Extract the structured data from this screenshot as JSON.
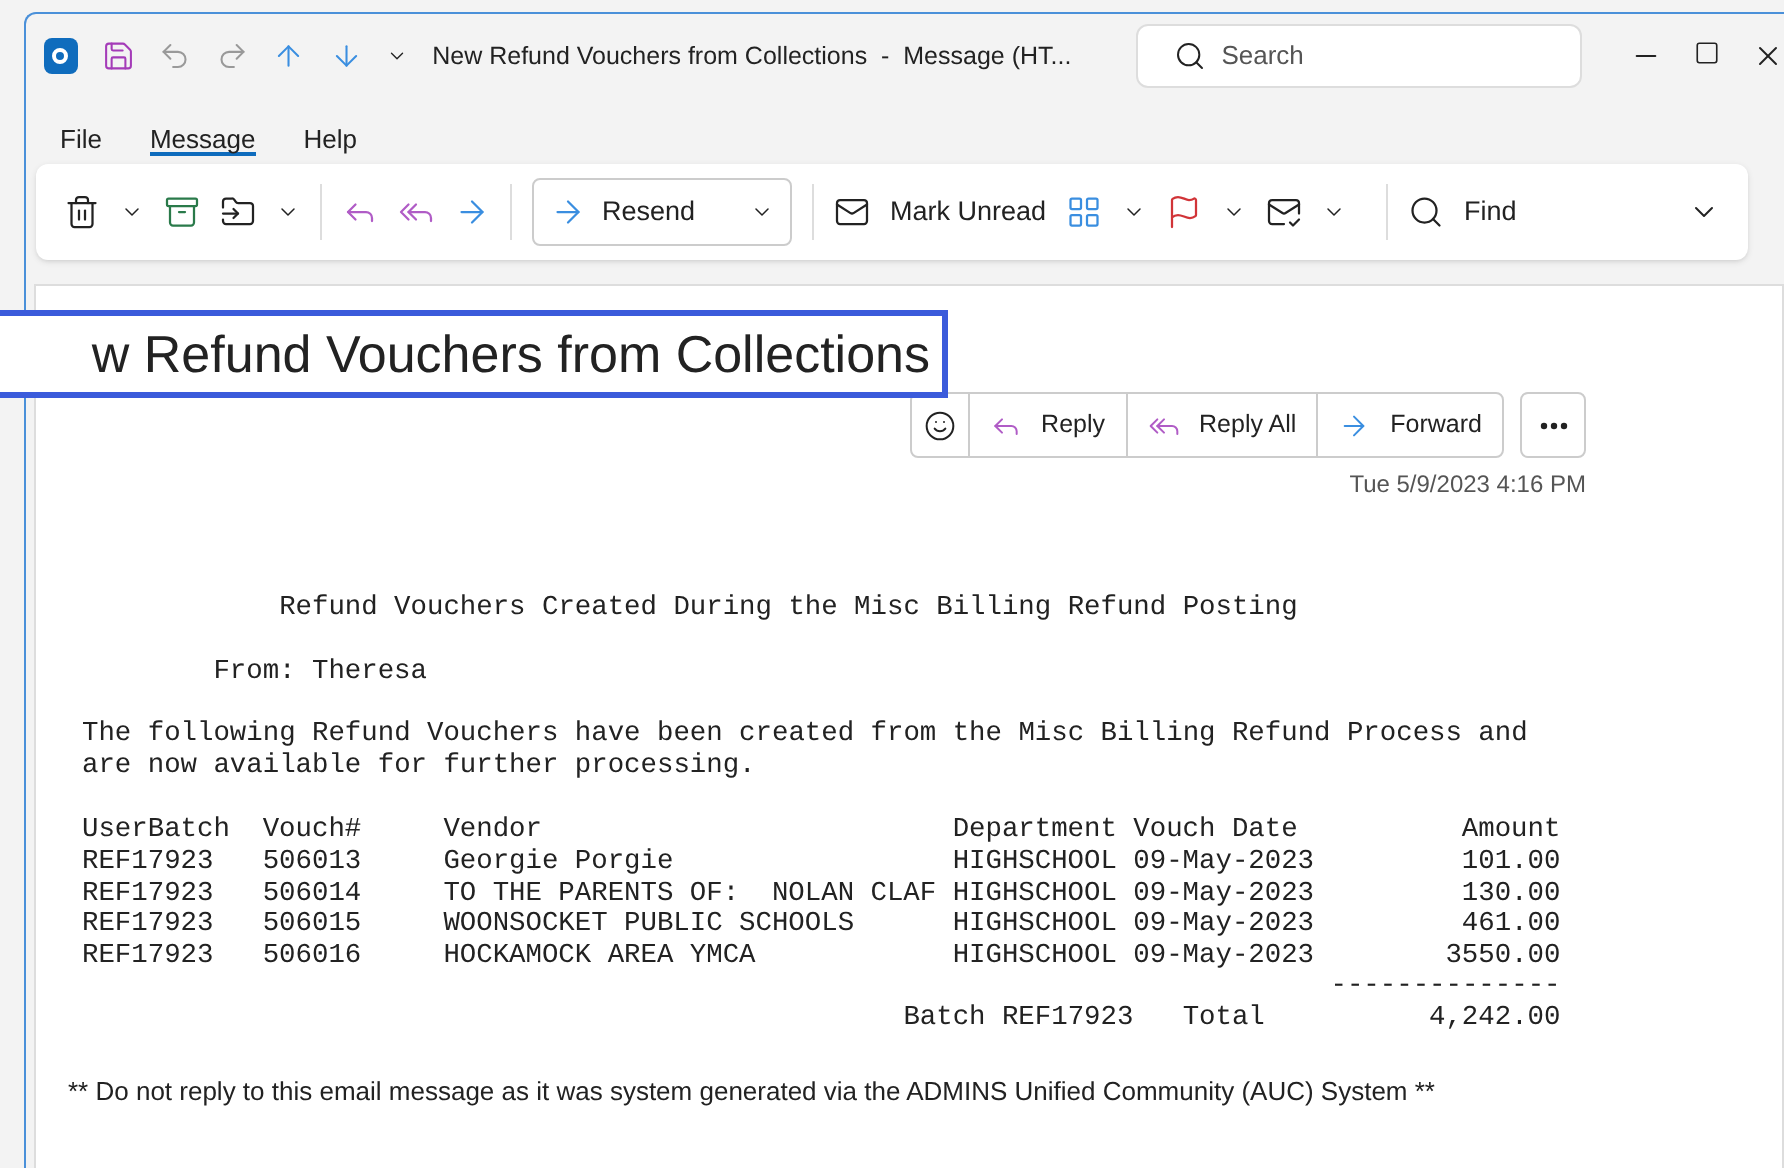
{
  "window": {
    "title": "New Refund Vouchers from Collections  -  Message (HT..."
  },
  "search": {
    "placeholder": "Search"
  },
  "menu": [
    {
      "label": "File",
      "selected": false
    },
    {
      "label": "Message",
      "selected": true
    },
    {
      "label": "Help",
      "selected": false
    }
  ],
  "ribbon": {
    "resend": "Resend",
    "mark_unread": "Mark Unread",
    "find": "Find"
  },
  "subject": "w Refund Vouchers from Collections",
  "actions": [
    "Reply",
    "Reply All",
    "Forward"
  ],
  "date": "Tue 5/9/2023 4:16 PM",
  "body": {
    "heading": "Refund Vouchers Created During the Misc Billing Refund Posting",
    "from": "From: Theresa",
    "intro": [
      "The following Refund Vouchers have been created from the Misc Billing Refund Process and",
      "are now available for further processing."
    ],
    "columns": [
      "UserBatch",
      "Vouch#",
      "Vendor",
      "Department",
      "Vouch Date",
      "Amount"
    ],
    "rows": [
      [
        "REF17923",
        "506013",
        "Georgie Porgie",
        "HIGHSCHOOL",
        "09-May-2023",
        "101.00"
      ],
      [
        "REF17923",
        "506014",
        "TO THE PARENTS OF:  NOLAN CLAF",
        "HIGHSCHOOL",
        "09-May-2023",
        "130.00"
      ],
      [
        "REF17923",
        "506015",
        "WOONSOCKET PUBLIC SCHOOLS",
        "HIGHSCHOOL",
        "09-May-2023",
        "461.00"
      ],
      [
        "REF17923",
        "506016",
        "HOCKAMOCK AREA YMCA",
        "HIGHSCHOOL",
        "09-May-2023",
        "3550.00"
      ]
    ],
    "rule": "--------------",
    "batch": "Batch REF17923",
    "total_label": "Total",
    "total": "4,242.00",
    "footer": "** Do not reply to this email message as it was system generated via the ADMINS Unified Community (AUC) System **"
  }
}
